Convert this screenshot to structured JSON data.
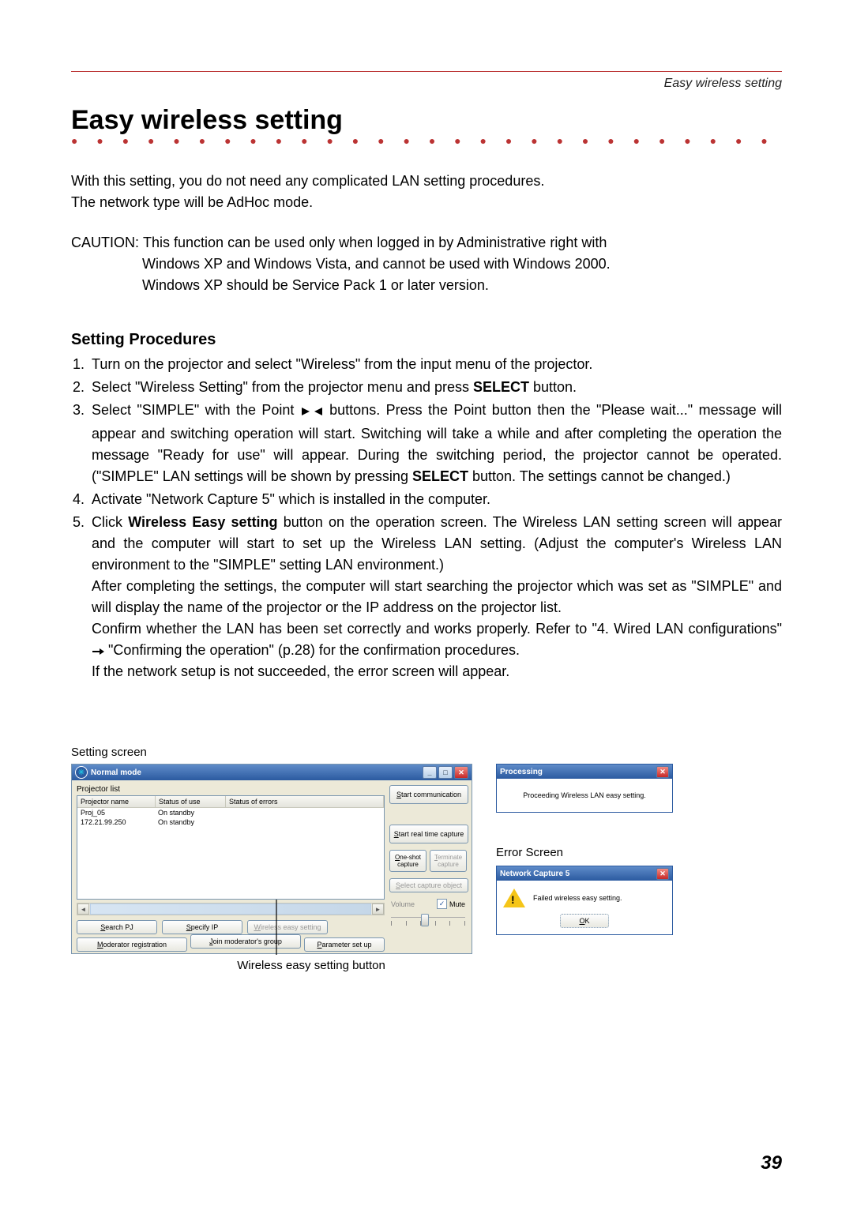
{
  "header_crumb": "Easy wireless setting",
  "h1": "Easy wireless setting",
  "intro_line1": "With this setting, you do not need any complicated LAN setting procedures.",
  "intro_line2": "The network type will be AdHoc mode.",
  "caution_label": "CAUTION: ",
  "caution_l1": "This function can be used only when logged in by Administrative right with",
  "caution_l2": "Windows XP and Windows Vista, and cannot be used with Windows 2000.",
  "caution_l3": "Windows XP should be Service Pack 1 or later version.",
  "h2": "Setting Procedures",
  "steps": {
    "s1": "Turn on the projector and select \"Wireless\" from the input menu of the projector.",
    "s2_a": "Select \"Wireless Setting\" from the projector menu and press ",
    "s2_bold": "SELECT",
    "s2_b": " button.",
    "s3_a": "Select \"SIMPLE\" with the Point ",
    "s3_b": " buttons. Press the Point button then the \"Please wait...\" message will appear and switching operation will start. Switching will take a while and after completing the operation the message \"Ready for use\" will appear. During the switching period, the projector cannot be operated. (\"SIMPLE\" LAN settings will be shown by pressing ",
    "s3_bold": "SELECT",
    "s3_c": " button. The settings cannot be changed.)",
    "s4": "Activate \"Network Capture 5\" which is installed in the computer.",
    "s5_a": "Click ",
    "s5_bold": "Wireless Easy setting",
    "s5_b": " button on the operation screen. The Wireless LAN setting screen will appear and the computer will start to set up the Wireless LAN setting. (Adjust the computer's Wireless LAN environment to the \"SIMPLE\" setting LAN environment.)",
    "s5_p2": "After completing the settings, the computer will start searching the projector which was set as \"SIMPLE\" and will display the name of the projector or the IP address on the projector list.",
    "s5_p3a": "Confirm whether the LAN has been set correctly and works properly. Refer to \"4. Wired LAN configurations\" ",
    "s5_p3b": " \"Confirming the operation\" (p.28) for the confirmation procedures.",
    "s5_p4": "If the network setup is not succeeded, the error screen will appear."
  },
  "setting_screen_label": "Setting screen",
  "app_window": {
    "title": "Normal mode",
    "projector_list_label": "Projector list",
    "columns": {
      "name": "Projector name",
      "status": "Status of use",
      "errors": "Status of errors"
    },
    "rows": [
      {
        "name": "Proj_05",
        "status": "On standby"
      },
      {
        "name": "172.21.99.250",
        "status": "On standby"
      }
    ],
    "buttons": {
      "search": "Search PJ",
      "specify": "Specify IP",
      "wireless_easy": "Wireless easy setting",
      "moderator_reg": "Moderator registration",
      "join_group": "Join moderator's group",
      "param_setup": "Parameter set up",
      "start_comm": "Start communication",
      "start_rtc": "Start real time capture",
      "oneshot": "One-shot capture",
      "terminate": "Terminate capture",
      "select_obj": "Select capture object"
    },
    "volume_label": "Volume",
    "mute_label": "Mute"
  },
  "callout_caption": "Wireless easy setting button",
  "processing_window": {
    "title": "Processing",
    "message": "Proceeding Wireless LAN easy setting."
  },
  "error_label": "Error Screen",
  "error_window": {
    "title": "Network Capture 5",
    "message": "Failed wireless easy setting.",
    "ok": "OK"
  },
  "page_number": "39"
}
